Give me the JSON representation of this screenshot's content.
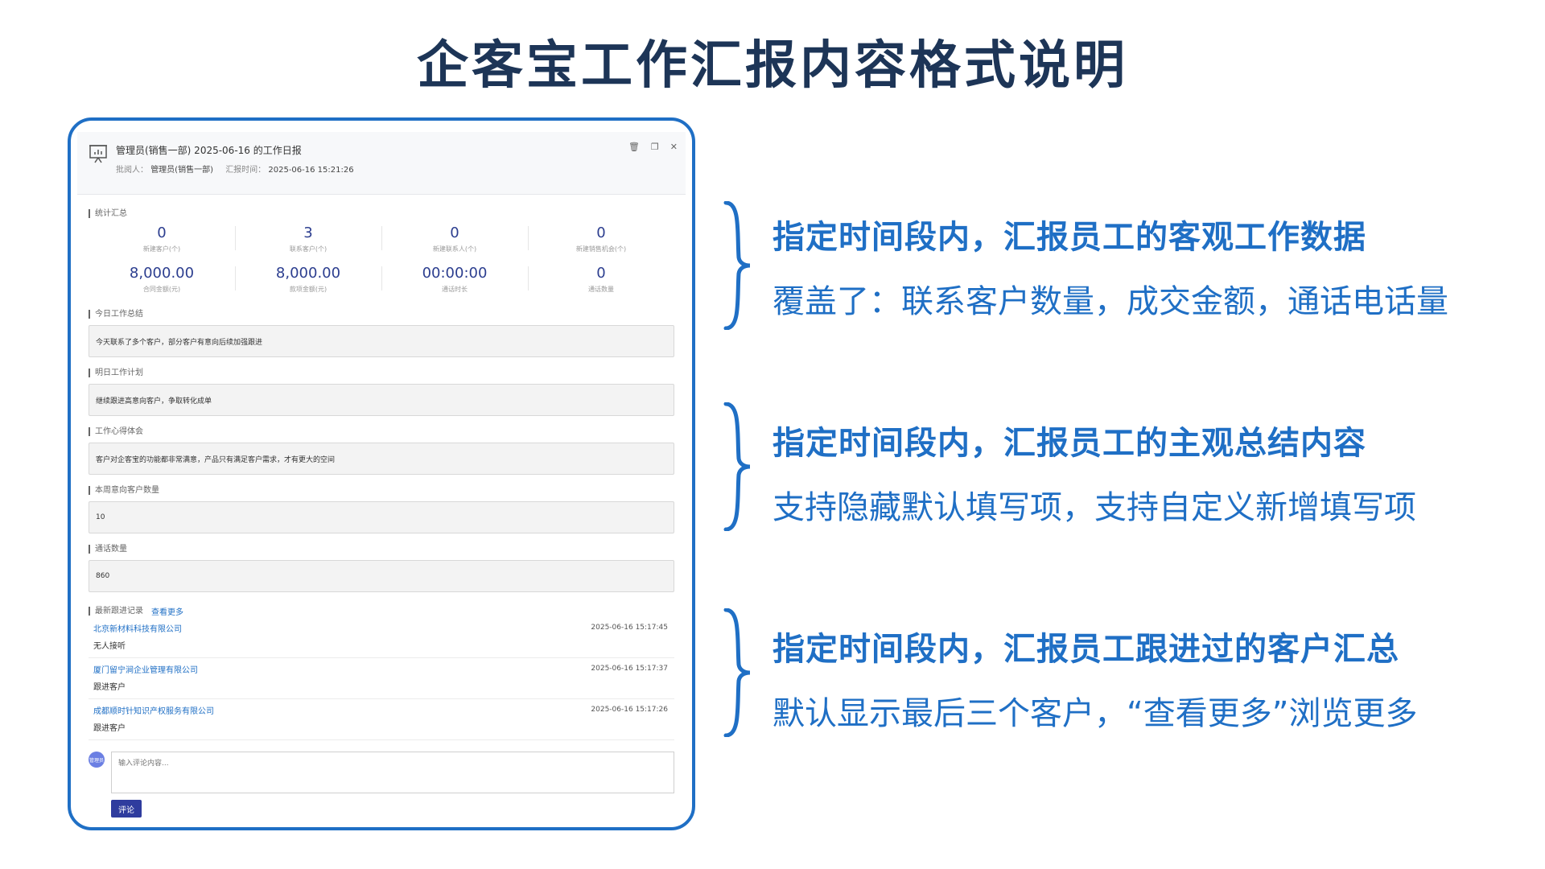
{
  "page": {
    "title": "企客宝工作汇报内容格式说明"
  },
  "dialog": {
    "title": "管理员(销售一部) 2025-06-16 的工作日报",
    "reviewer_label": "批阅人：",
    "reviewer": "管理员(销售一部)",
    "report_time_label": "汇报时间：",
    "report_time": "2025-06-16 15:21:26",
    "icons": {
      "report": "chart-board-icon",
      "delete": "trash-icon",
      "copy": "copy-icon",
      "close": "close-icon"
    }
  },
  "stats": {
    "label": "统计汇总",
    "items": [
      {
        "value": "0",
        "label": "新建客户(个)"
      },
      {
        "value": "3",
        "label": "联系客户(个)"
      },
      {
        "value": "0",
        "label": "新建联系人(个)"
      },
      {
        "value": "0",
        "label": "新建销售机会(个)"
      },
      {
        "value": "8,000.00",
        "label": "合同金额(元)"
      },
      {
        "value": "8,000.00",
        "label": "款项金额(元)"
      },
      {
        "value": "00:00:00",
        "label": "通话时长"
      },
      {
        "value": "0",
        "label": "通话数量"
      }
    ]
  },
  "fields": [
    {
      "label": "今日工作总结",
      "value": "今天联系了多个客户，部分客户有意向后续加强跟进"
    },
    {
      "label": "明日工作计划",
      "value": "继续跟进高意向客户，争取转化成单"
    },
    {
      "label": "工作心得体会",
      "value": "客户对企客宝的功能都非常满意，产品只有满足客户需求，才有更大的空间"
    },
    {
      "label": "本周意向客户数量",
      "value": "10"
    },
    {
      "label": "通话数量",
      "value": "860"
    }
  ],
  "follow": {
    "label": "最新跟进记录",
    "more": "查看更多",
    "items": [
      {
        "name": "北京新材料科技有限公司",
        "status": "无人接听",
        "time": "2025-06-16 15:17:45"
      },
      {
        "name": "厦门留宁涧企业管理有限公司",
        "status": "跟进客户",
        "time": "2025-06-16 15:17:37"
      },
      {
        "name": "成都顺时针知识产权服务有限公司",
        "status": "跟进客户",
        "time": "2025-06-16 15:17:26"
      }
    ]
  },
  "comment": {
    "avatar": "管理员",
    "placeholder": "输入评论内容...",
    "button": "评论"
  },
  "callouts": [
    {
      "head": "指定时间段内，汇报员工的客观工作数据",
      "sub": "覆盖了：联系客户数量，成交金额，通话电话量"
    },
    {
      "head": "指定时间段内，汇报员工的主观总结内容",
      "sub": "支持隐藏默认填写项，支持自定义新增填写项"
    },
    {
      "head": "指定时间段内，汇报员工跟进过的客户汇总",
      "sub": "默认显示最后三个客户，“查看更多”浏览更多"
    }
  ],
  "colors": {
    "accent": "#1f6fc5",
    "title": "#1d3557",
    "button": "#2f3c9e"
  }
}
